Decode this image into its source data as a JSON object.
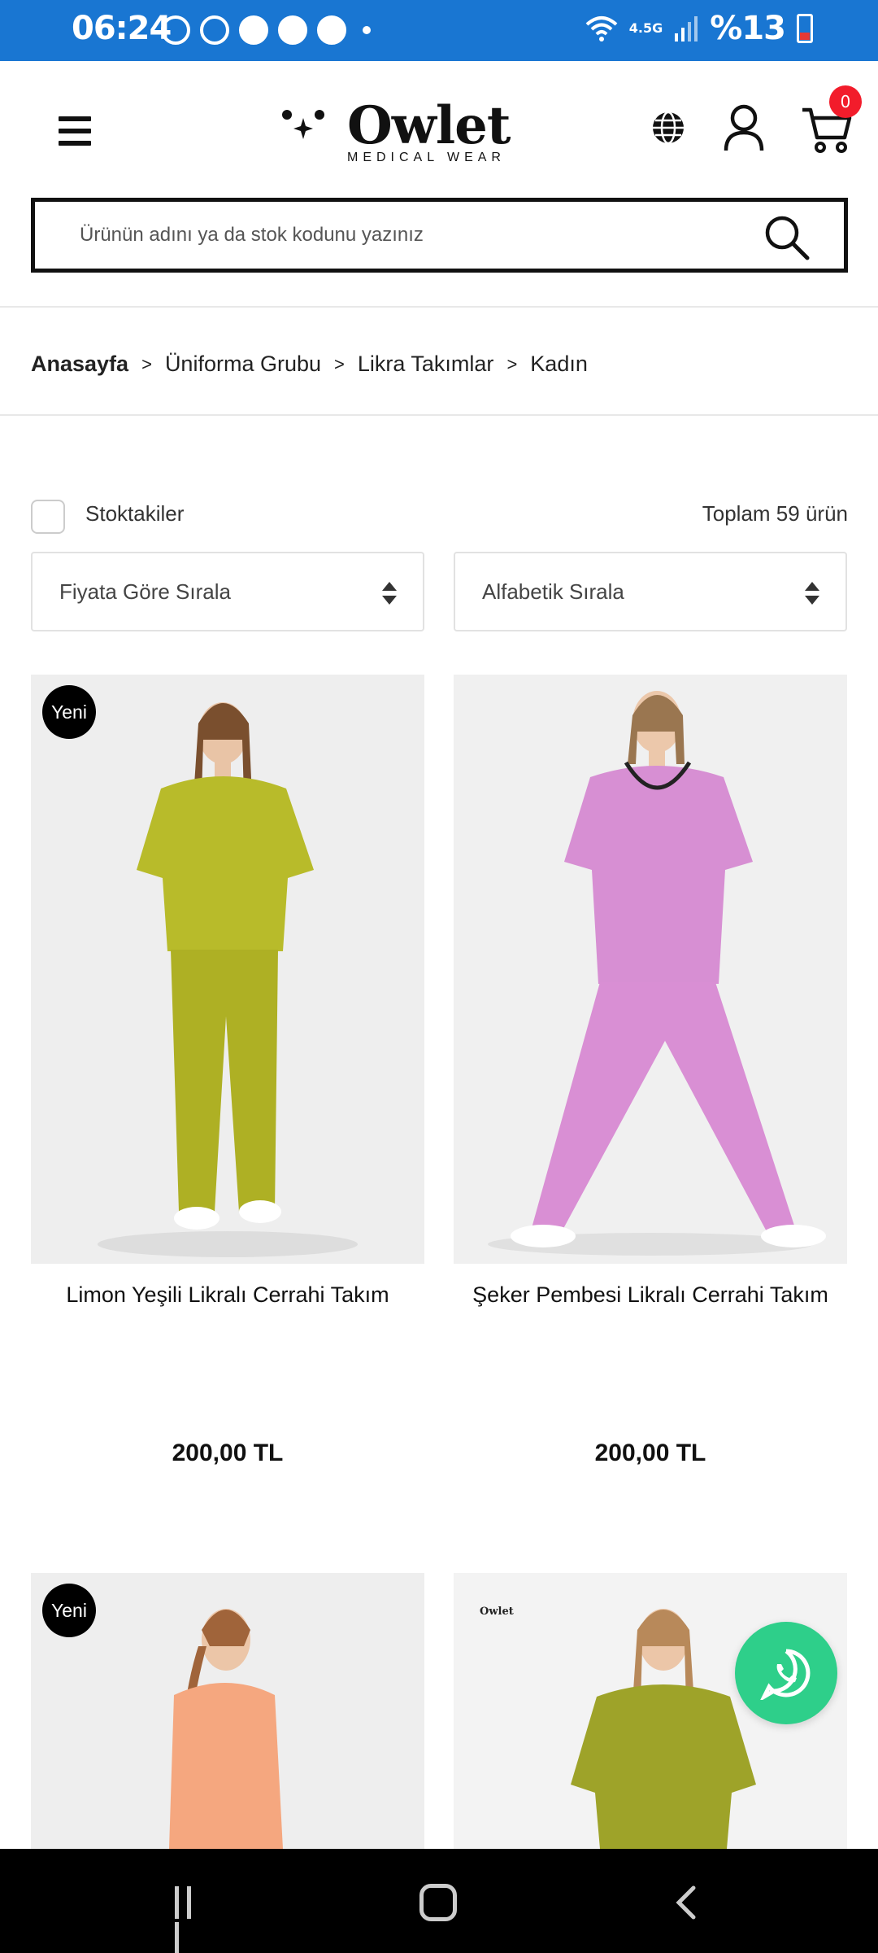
{
  "status_bar": {
    "time": "06:24",
    "network": "4.5G",
    "battery_text": "%13",
    "icons": [
      "sync-icon",
      "accessibility-icon",
      "app-icon",
      "chrome-icon",
      "chrome-icon",
      "dot-icon",
      "wifi-icon",
      "signal-icon",
      "battery-icon"
    ]
  },
  "header": {
    "brand": "Owlet",
    "brand_sub": "MEDICAL WEAR",
    "cart_count": "0"
  },
  "search": {
    "placeholder": "Ürünün adını ya da stok kodunu yazınız"
  },
  "breadcrumb": {
    "items": [
      "Anasayfa",
      "Üniforma Grubu",
      "Likra Takımlar",
      "Kadın"
    ],
    "separator": ">"
  },
  "filters": {
    "stock_label": "Stoktakiler",
    "total_text": "Toplam 59 ürün",
    "sort_price": "Fiyata Göre Sırala",
    "sort_alpha": "Alfabetik Sırala"
  },
  "products": [
    {
      "name": "Limon Yeşili Likralı Cerrahi Takım",
      "price": "200,00 TL",
      "badge": "Yeni",
      "color": "#b8bb2a"
    },
    {
      "name": "Şeker Pembesi Likralı Cerrahi Takım",
      "price": "200,00 TL",
      "badge": "",
      "color": "#d78fd3"
    },
    {
      "name": "",
      "price": "",
      "badge": "Yeni",
      "color": "#f5a77f"
    },
    {
      "name": "",
      "price": "",
      "badge": "",
      "color": "#9ea329",
      "brand_mark": "Owlet"
    }
  ],
  "colors": {
    "status_bar": "#1976d2",
    "cart_badge": "#f21c2b",
    "whatsapp": "#2ecf8a"
  }
}
